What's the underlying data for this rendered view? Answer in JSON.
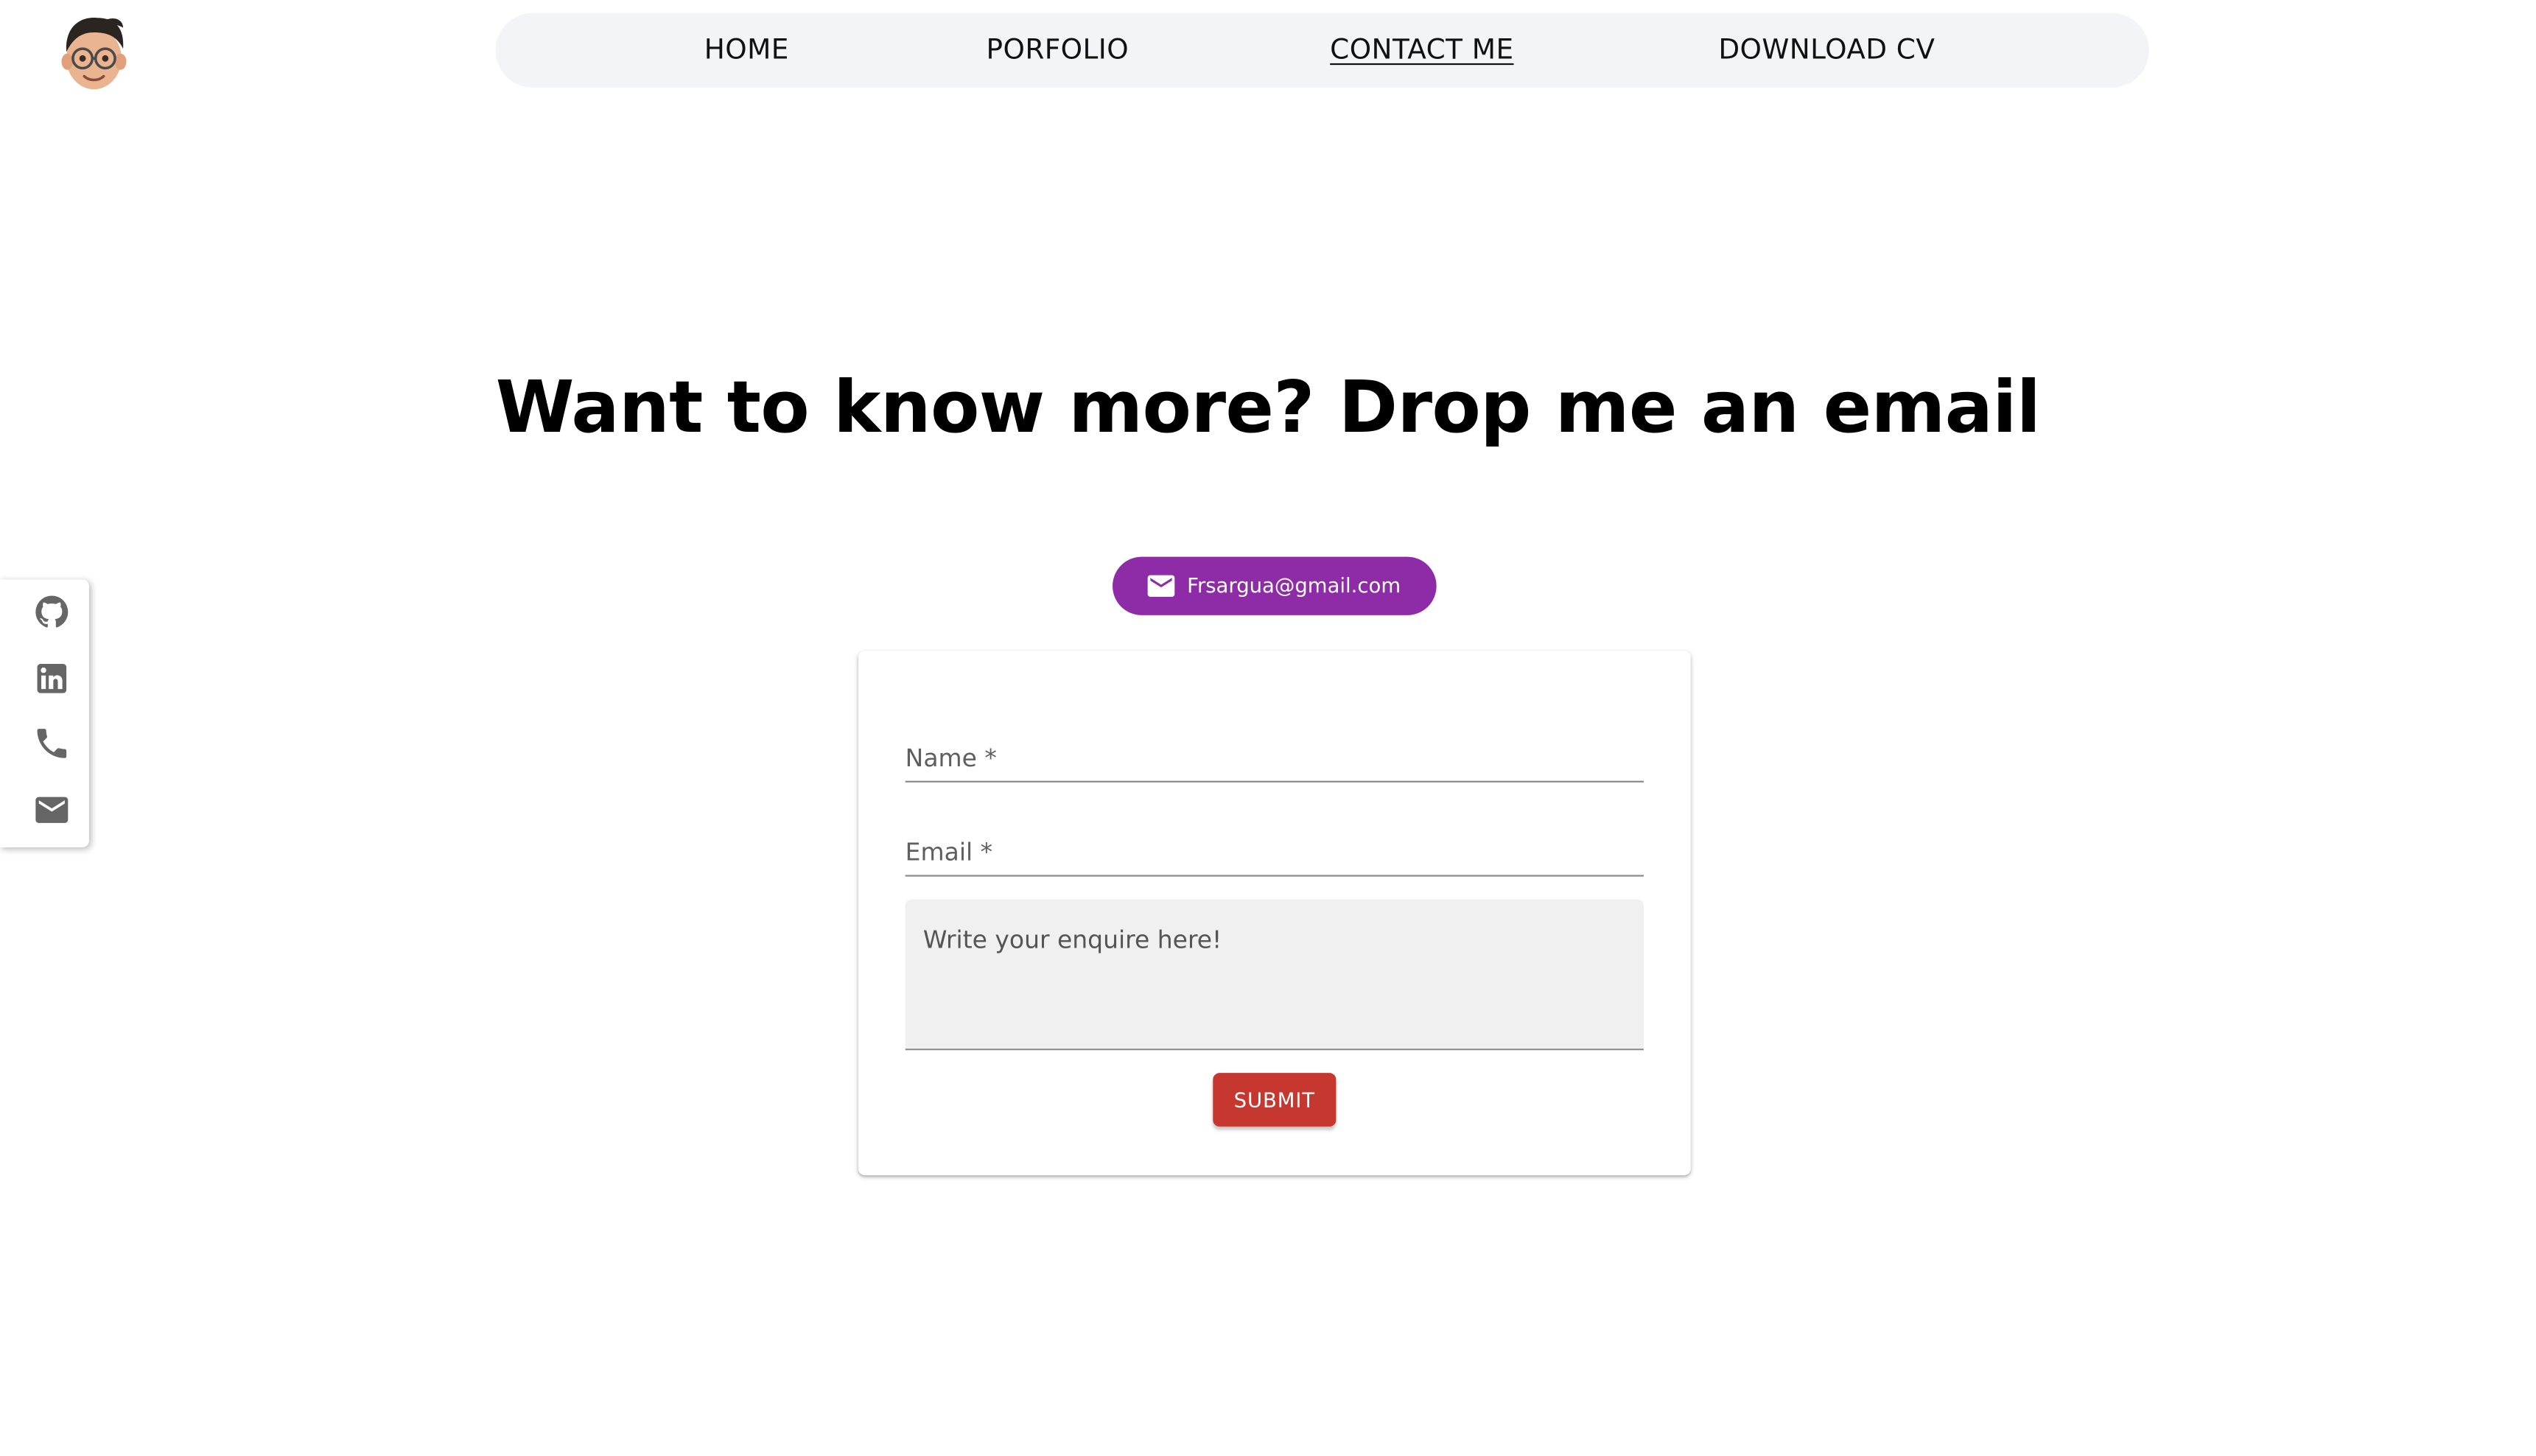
{
  "nav": {
    "items": [
      {
        "label": "HOME",
        "active": false
      },
      {
        "label": "PORFOLIO",
        "active": false
      },
      {
        "label": "CONTACT ME",
        "active": true
      },
      {
        "label": "DOWNLOAD CV",
        "active": false
      }
    ]
  },
  "avatar": {
    "icon": "memoji-avatar-icon"
  },
  "hero": {
    "headline": "Want to know more? Drop me an email"
  },
  "email_chip": {
    "label": "Frsargua@gmail.com",
    "icon": "mail-icon",
    "color": "#8e2ca8"
  },
  "social": {
    "items": [
      {
        "icon": "github-icon"
      },
      {
        "icon": "linkedin-icon"
      },
      {
        "icon": "phone-icon"
      },
      {
        "icon": "mail-icon"
      }
    ]
  },
  "form": {
    "name_label": "Name *",
    "email_label": "Email *",
    "message_placeholder": "Write your enquire here!",
    "submit_label": "SUBMIT",
    "submit_color": "#c6372f"
  }
}
